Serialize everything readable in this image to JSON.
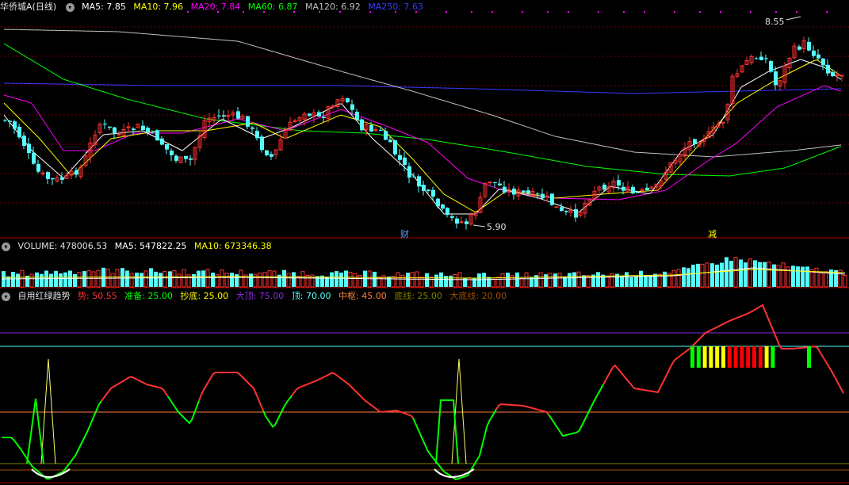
{
  "price_panel": {
    "stock_name": "华侨城A",
    "period": "(日线)",
    "ma5_label": "MA5: 7.85",
    "ma10_label": "MA10: 7.96",
    "ma20_label": "MA20: 7.84",
    "ma60_label": "MA60: 6.87",
    "ma120_label": "MA120: 6.92",
    "ma250_label": "MA250: 7.63",
    "high_marker": "8.55",
    "low_marker": "5.90",
    "event_marker_1": "财",
    "event_marker_2": "减"
  },
  "volume_panel": {
    "volume_label": "VOLUME: 478006.53",
    "ma5_label": "MA5: 547822.25",
    "ma10_label": "MA10: 673346.38"
  },
  "indicator_panel": {
    "name": "自用红绿趋势",
    "trend_label": "势: 50.55",
    "prepare_label": "准备: 25.00",
    "bottom_buy_label": "抄底: 25.00",
    "big_top_label": "大顶: 75.00",
    "top_label": "顶: 70.00",
    "center_label": "中枢: 45.00",
    "bottom_line_label": "底线: 25.00",
    "big_bottom_label": "大底线: 20.00"
  },
  "colors": {
    "up": "#ff3232",
    "down": "#54ffff",
    "ma5": "#ffffff",
    "ma10": "#ffff00",
    "ma20": "#ff00ff",
    "ma60": "#00ff00",
    "ma120": "#c0c0c0",
    "ma250": "#3a3aff",
    "grid": "#7a0000"
  }
}
